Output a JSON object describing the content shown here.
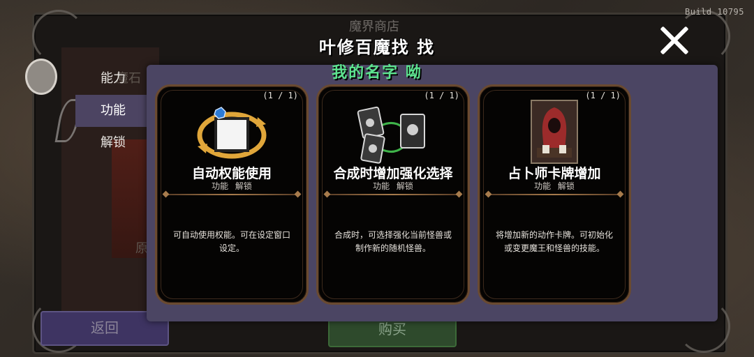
{
  "build_label": "Build 10795",
  "background": {
    "shop_title": "魔界商店",
    "behind_text_1": "魔石",
    "behind_text_2": "原",
    "back_label": "返回",
    "buy_label": "购买"
  },
  "side_tabs": [
    {
      "label": "能力",
      "active": false
    },
    {
      "label": "功能",
      "active": true
    },
    {
      "label": "解锁",
      "active": false
    }
  ],
  "overlay": {
    "title": "叶修百魔找 找",
    "subtitle": "我的名字 呦"
  },
  "cards": [
    {
      "count": "(1 / 1)",
      "name": "自动权能使用",
      "tags": [
        "功能",
        "解锁"
      ],
      "description": "可自动使用权能。可在设定窗口设定。",
      "icon": "auto-cycle-icon"
    },
    {
      "count": "(1 / 1)",
      "name": "合成时增加强化选择",
      "tags": [
        "功能",
        "解锁"
      ],
      "description": "合成时，可选择强化当前怪兽或制作新的随机怪兽。",
      "icon": "card-merge-icon"
    },
    {
      "count": "(1 / 1)",
      "name": "占卜师卡牌增加",
      "tags": [
        "功能",
        "解锁"
      ],
      "description": "将增加新的动作卡牌。可初始化或变更魔王和怪兽的技能。",
      "icon": "fortune-teller-icon"
    }
  ],
  "colors": {
    "popup_bg": "#4b4563",
    "active_tab": "#4c4462",
    "subtitle_green": "#5ce38e",
    "card_border": "#6a4a30"
  }
}
